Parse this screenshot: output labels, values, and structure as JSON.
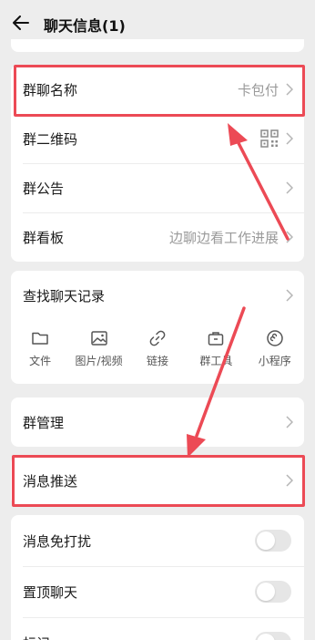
{
  "header": {
    "title": "聊天信息(1)"
  },
  "group_info": {
    "rows": [
      {
        "label": "群聊名称",
        "value": "卡包付"
      },
      {
        "label": "群二维码"
      },
      {
        "label": "群公告"
      },
      {
        "label": "群看板",
        "value": "边聊边看工作进展"
      }
    ]
  },
  "history": {
    "label": "查找聊天记录",
    "tools": [
      {
        "label": "文件",
        "icon": "folder-icon"
      },
      {
        "label": "图片/视频",
        "icon": "image-icon"
      },
      {
        "label": "链接",
        "icon": "link-icon"
      },
      {
        "label": "群工具",
        "icon": "toolbox-icon"
      },
      {
        "label": "小程序",
        "icon": "mini-program-icon"
      }
    ]
  },
  "manage": {
    "label": "群管理"
  },
  "push": {
    "label": "消息推送"
  },
  "settings": {
    "rows": [
      {
        "label": "消息免打扰",
        "on": false
      },
      {
        "label": "置顶聊天",
        "on": false
      },
      {
        "label": "标记",
        "on": false
      }
    ]
  },
  "colors": {
    "highlight": "#ec4a55",
    "background": "#ededed",
    "card": "#ffffff"
  }
}
